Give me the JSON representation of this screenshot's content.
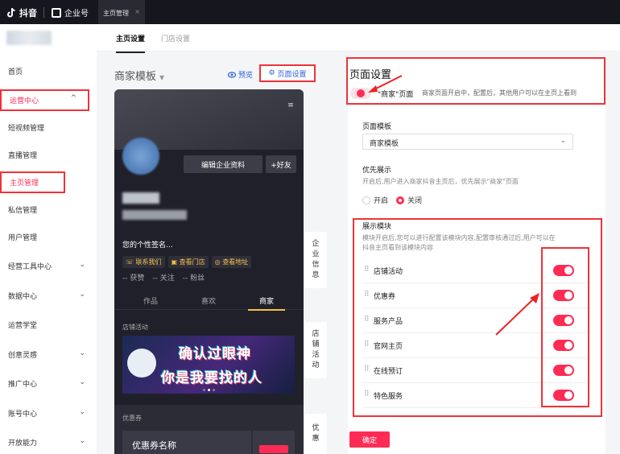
{
  "topbar": {
    "brand": "抖音",
    "enterprise": "企业号",
    "tab": "主页管理"
  },
  "sidebar": {
    "items": [
      {
        "label": "首页"
      },
      {
        "label": "运营中心"
      },
      {
        "label": "短视频管理"
      },
      {
        "label": "直播管理"
      },
      {
        "label": "主页管理"
      },
      {
        "label": "私信管理"
      },
      {
        "label": "用户管理"
      },
      {
        "label": "经营工具中心"
      },
      {
        "label": "数据中心"
      },
      {
        "label": "运营学堂"
      },
      {
        "label": "创意灵感"
      },
      {
        "label": "推广中心"
      },
      {
        "label": "账号中心"
      },
      {
        "label": "开放能力"
      }
    ]
  },
  "subtabs": {
    "home_settings": "主页设置",
    "store_settings": "门店设置"
  },
  "left": {
    "template_title": "商家模板",
    "preview": "预览",
    "page_settings_btn": "页面设置"
  },
  "phone": {
    "edit_profile": "编辑企业资料",
    "add_friend": "+好友",
    "signature": "您的个性签名...",
    "chips": [
      "联系我们",
      "查看门店",
      "查看地址"
    ],
    "stats": [
      "-- 获赞",
      "-- 关注",
      "-- 粉丝"
    ],
    "tabs": [
      "作品",
      "喜欢",
      "商家"
    ],
    "store_activity": "店铺活动",
    "banner_line1": "确认过眼神",
    "banner_line2": "你是我要找的人",
    "coupon_label": "优惠券",
    "coupon_name": "优惠券名称"
  },
  "vlabels": {
    "enterprise_info": [
      "企",
      "业",
      "信",
      "息"
    ],
    "store_activity": [
      "店",
      "铺",
      "活",
      "动"
    ],
    "coupon": [
      "优",
      "惠"
    ]
  },
  "right": {
    "title": "页面设置",
    "shop_page_label": "\"商家\"页面",
    "shop_page_desc": "商家页面开启中，配置后，其他用户可以在主页上看到",
    "page_template_label": "页面模板",
    "page_template_value": "商家模板",
    "priority_label": "优先展示",
    "priority_desc": "开启后,用户进入商家抖音主页后，优先展示\"商家\"页面",
    "radio_on": "开启",
    "radio_off": "关闭",
    "modules_label": "展示模块",
    "modules_desc1": "模块开启后,您可以进行配置该模块内容,配置审核通过后,用户可以在",
    "modules_desc2": "抖音主页看到该模块内容",
    "modules": [
      {
        "name": "店铺活动"
      },
      {
        "name": "优惠券"
      },
      {
        "name": "服务产品"
      },
      {
        "name": "官网主页"
      },
      {
        "name": "在线预订"
      },
      {
        "name": "特色服务"
      }
    ],
    "confirm": "确定"
  },
  "colors": {
    "accent": "#fe2c55",
    "highlight": "#f0323a",
    "link": "#2b5fd9"
  }
}
